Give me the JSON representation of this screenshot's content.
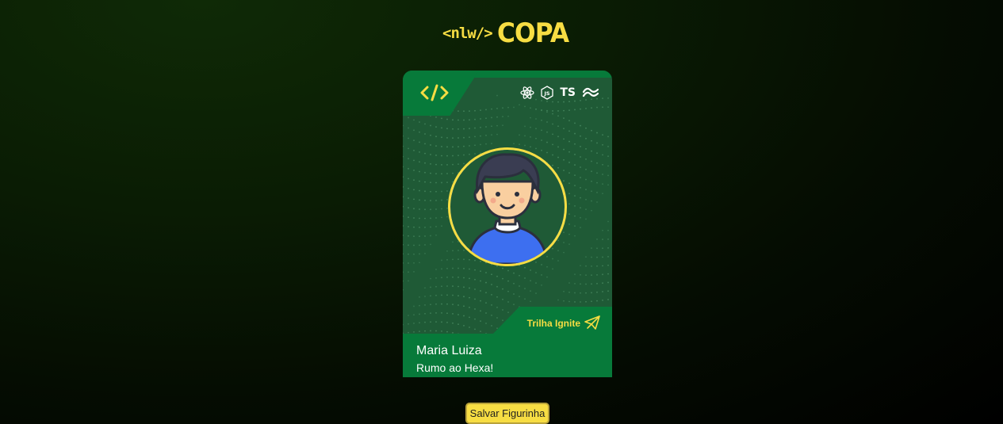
{
  "header": {
    "logo_prefix": "<nlw/>",
    "logo_title": "COPA"
  },
  "card": {
    "tech_icons": [
      "react-icon",
      "nodejs-icon",
      "typescript-icon",
      "tailwind-icon"
    ],
    "ts_label": "TS",
    "avatar_icon": "user-avatar",
    "trail_label": "Trilha Ignite",
    "trail_icon": "paper-plane-icon",
    "name": "Maria Luiza",
    "slogan": "Rumo ao Hexa!"
  },
  "actions": {
    "save_label": "Salvar Figurinha"
  },
  "colors": {
    "accent_yellow": "#f7dd43",
    "card_green": "#077a3a",
    "card_dark_green": "#1f5a36",
    "background": "#000000"
  }
}
